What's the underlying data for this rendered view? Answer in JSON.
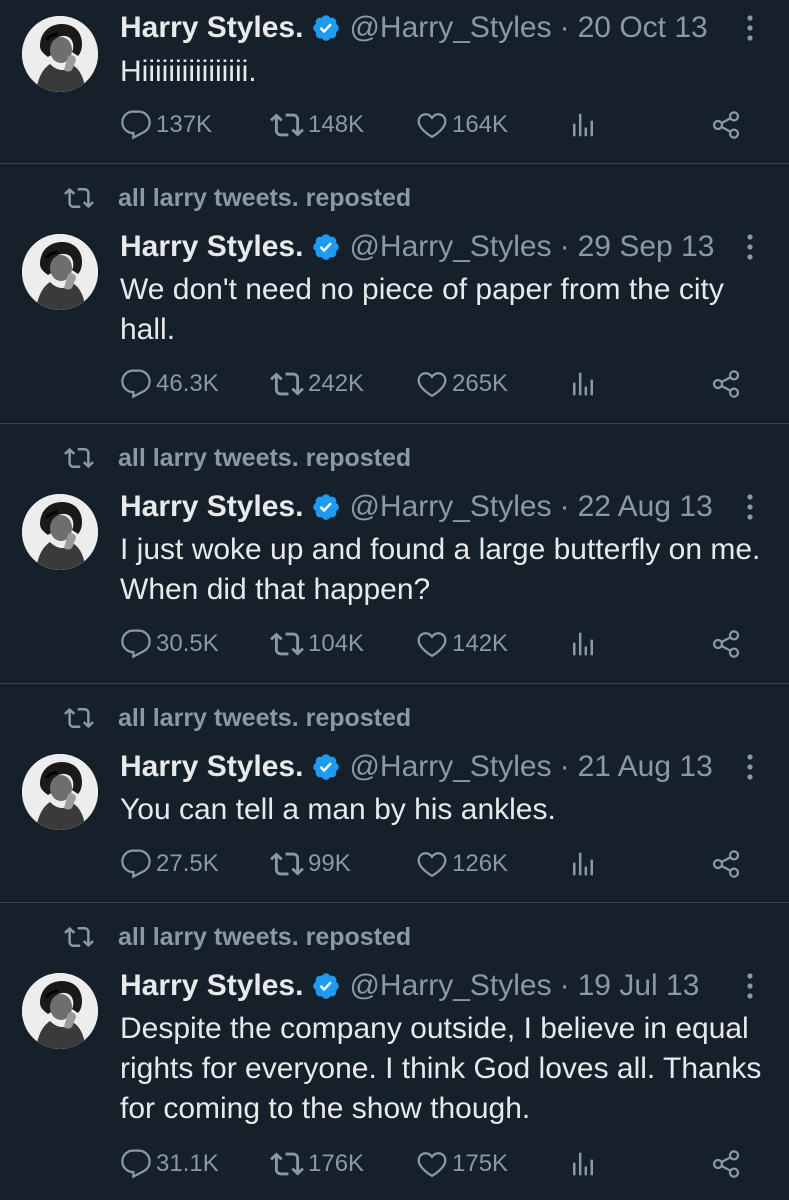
{
  "colors": {
    "background": "#15202b",
    "text": "#e7e9ea",
    "muted": "#8b98a5",
    "verified": "#1d9bf0",
    "divider": "#38444d"
  },
  "icons": {
    "reply": "speech-bubble-icon",
    "retweet": "retweet-arrows-icon",
    "like": "heart-outline-icon",
    "views": "bar-chart-icon",
    "share": "share-nodes-icon",
    "more": "vertical-ellipsis-icon",
    "verified": "verified-badge-icon"
  },
  "tweets": [
    {
      "repost_label": "",
      "name": "Harry Styles.",
      "handle": "@Harry_Styles",
      "separator": "·",
      "date": "20 Oct 13",
      "text": "Hiiiiiiiiiiiiiiii.",
      "replies": "137K",
      "retweets": "148K",
      "likes": "164K"
    },
    {
      "repost_label": "all larry tweets. reposted",
      "name": "Harry Styles.",
      "handle": "@Harry_Styles",
      "separator": "·",
      "date": "29 Sep 13",
      "text": "We don't need no piece of paper from the city hall.",
      "replies": "46.3K",
      "retweets": "242K",
      "likes": "265K"
    },
    {
      "repost_label": "all larry tweets. reposted",
      "name": "Harry Styles.",
      "handle": "@Harry_Styles",
      "separator": "·",
      "date": "22 Aug 13",
      "text": "I just woke up and found a large butterfly on me. When did that happen?",
      "replies": "30.5K",
      "retweets": "104K",
      "likes": "142K"
    },
    {
      "repost_label": "all larry tweets. reposted",
      "name": "Harry Styles.",
      "handle": "@Harry_Styles",
      "separator": "·",
      "date": "21 Aug 13",
      "text": "You can tell a man by his ankles.",
      "replies": "27.5K",
      "retweets": "99K",
      "likes": "126K"
    },
    {
      "repost_label": "all larry tweets. reposted",
      "name": "Harry Styles.",
      "handle": "@Harry_Styles",
      "separator": "·",
      "date": "19 Jul 13",
      "text": "Despite the company outside, I believe in equal rights for everyone. I think God loves all. Thanks for coming to the show though.",
      "replies": "31.1K",
      "retweets": "176K",
      "likes": "175K"
    }
  ]
}
